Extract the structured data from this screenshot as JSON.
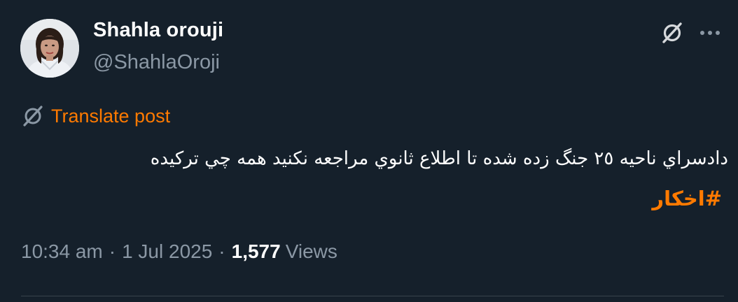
{
  "author": {
    "display_name": "Shahla orouji",
    "handle": "@ShahlaOroji"
  },
  "header_icons": {
    "grok": "grok-icon",
    "more": "more-icon"
  },
  "translate": {
    "icon": "translate-icon",
    "label": "Translate post"
  },
  "post": {
    "text": "دادسراي ناحيه ٢٥ جنگ زده شده تا اطلاع ثانوي مراجعه نكنيد همه چي تركيده",
    "hashtag": "#اخكار"
  },
  "meta": {
    "time": "10:34 am",
    "separator": "·",
    "date": "1 Jul 2025",
    "views_count": "1,577",
    "views_label": "Views"
  },
  "colors": {
    "background": "#15202b",
    "accent": "#ff7a00",
    "secondary_text": "#8b98a5",
    "primary_text": "#ffffff"
  }
}
